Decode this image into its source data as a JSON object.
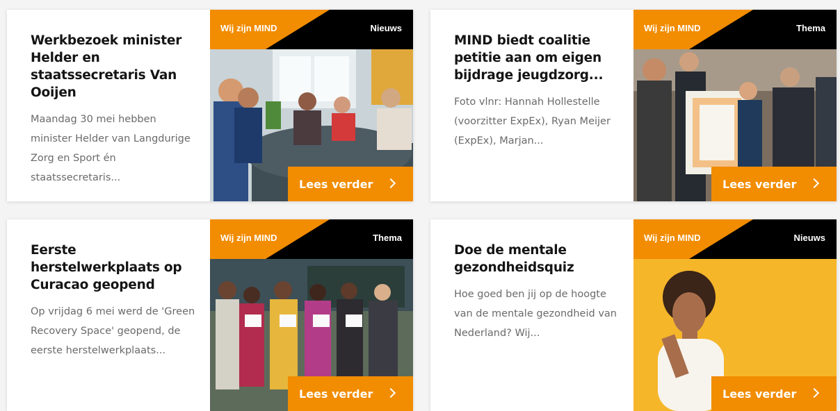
{
  "colors": {
    "brand_orange": "#f28c00",
    "label_black": "#000000"
  },
  "cards": [
    {
      "title": "Werkbezoek minister Helder en staatssecretaris Van Ooijen",
      "excerpt": "Maandag 30 mei hebben minister Helder van Langdurige Zorg en Sport én staatssecretaris...",
      "label_left": "Wij zijn MIND",
      "label_right": "Nieuws",
      "button": "Lees verder"
    },
    {
      "title": "MIND biedt coalitie petitie aan om eigen bijdrage jeugdzorg...",
      "excerpt": "Foto vlnr: Hannah Hollestelle (voorzitter ExpEx), Ryan Meijer (ExpEx), Marjan...",
      "label_left": "Wij zijn MIND",
      "label_right": "Thema",
      "button": "Lees verder"
    },
    {
      "title": "Eerste herstelwerkplaats op Curacao geopend",
      "excerpt": "Op vrijdag 6 mei werd de 'Green Recovery Space' geopend, de eerste herstelwerkplaats...",
      "label_left": "Wij zijn MIND",
      "label_right": "Thema",
      "button": "Lees verder"
    },
    {
      "title": "Doe de mentale gezondheidsquiz",
      "excerpt": "Hoe goed ben jij op de hoogte van de mentale gezondheid van Nederland? Wij...",
      "label_left": "Wij zijn MIND",
      "label_right": "Nieuws",
      "button": "Lees verder"
    }
  ]
}
